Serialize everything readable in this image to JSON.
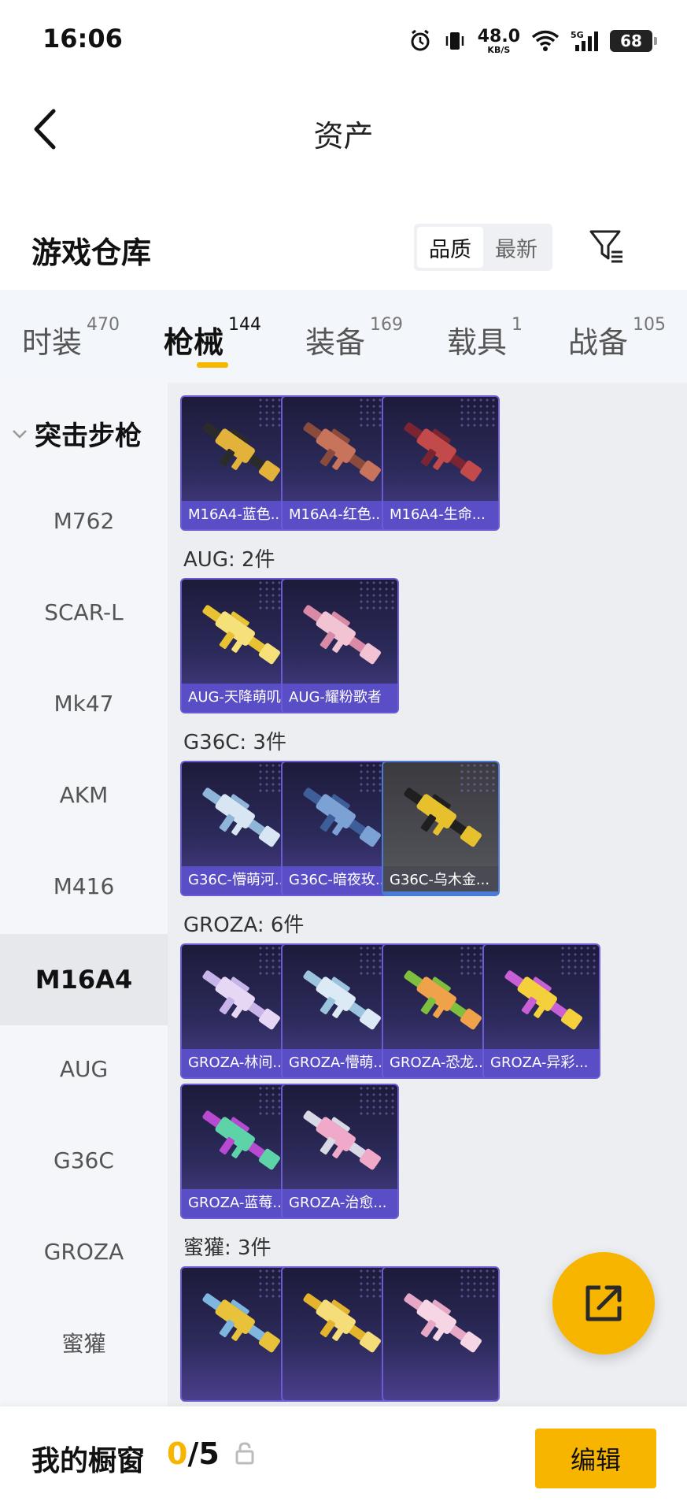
{
  "status_bar": {
    "time": "16:06",
    "net_speed": "48.0",
    "net_unit": "KB/S",
    "network": "5G",
    "battery": "68"
  },
  "header": {
    "title": "资产"
  },
  "warehouse": {
    "title": "游戏仓库",
    "sort_options": [
      "品质",
      "最新"
    ],
    "sort_selected": "品质"
  },
  "tabs": [
    {
      "label": "时装",
      "count": "470"
    },
    {
      "label": "枪械",
      "count": "144"
    },
    {
      "label": "装备",
      "count": "169"
    },
    {
      "label": "载具",
      "count": "1"
    },
    {
      "label": "战备",
      "count": "105"
    }
  ],
  "active_tab": "枪械",
  "sidebar": {
    "group_label": "突击步枪",
    "items": [
      "M762",
      "SCAR-L",
      "Mk47",
      "AKM",
      "M416",
      "M16A4",
      "AUG",
      "G36C",
      "GROZA",
      "蜜獾"
    ],
    "active_item": "M16A4"
  },
  "sections": [
    {
      "title": "",
      "items": [
        {
          "name": "M16A4-蓝色...",
          "color1": "#2b2b2b",
          "color2": "#e2b23a",
          "grey": false
        },
        {
          "name": "M16A4-红色...",
          "color1": "#8a4b3c",
          "color2": "#c8735b",
          "grey": false
        },
        {
          "name": "M16A4-生命...",
          "color1": "#7a2531",
          "color2": "#c24a4a",
          "grey": false
        }
      ]
    },
    {
      "title": "AUG: 2件",
      "items": [
        {
          "name": "AUG-天降萌叽",
          "color1": "#e8c232",
          "color2": "#f5e07a",
          "grey": false
        },
        {
          "name": "AUG-耀粉歌者",
          "color1": "#d98aa6",
          "color2": "#f2c3d3",
          "grey": false
        }
      ]
    },
    {
      "title": "G36C: 3件",
      "items": [
        {
          "name": "G36C-懵萌河...",
          "color1": "#8fb6d9",
          "color2": "#d7e6f2",
          "grey": false
        },
        {
          "name": "G36C-暗夜玫...",
          "color1": "#3e5e9a",
          "color2": "#7ca1d4",
          "grey": false
        },
        {
          "name": "G36C-乌木金...",
          "color1": "#1f1f1f",
          "color2": "#e6c12d",
          "grey": true
        }
      ]
    },
    {
      "title": "GROZA: 6件",
      "items": [
        {
          "name": "GROZA-林间...",
          "color1": "#c7b4e8",
          "color2": "#e6d8f5",
          "grey": false
        },
        {
          "name": "GROZA-懵萌...",
          "color1": "#9cc4de",
          "color2": "#dbeaf4",
          "grey": false
        },
        {
          "name": "GROZA-恐龙...",
          "color1": "#7fbf3e",
          "color2": "#f0a24a",
          "grey": false
        },
        {
          "name": "GROZA-异彩...",
          "color1": "#c95fd6",
          "color2": "#f4d03c",
          "grey": false
        },
        {
          "name": "GROZA-蓝莓...",
          "color1": "#b84ad2",
          "color2": "#5fd3a8",
          "grey": false
        },
        {
          "name": "GROZA-治愈...",
          "color1": "#d9d9e6",
          "color2": "#f1a9c9",
          "grey": false
        }
      ]
    },
    {
      "title": "蜜獾: 3件",
      "items": [
        {
          "name": "",
          "color1": "#7fb6e0",
          "color2": "#e8c23a",
          "grey": false
        },
        {
          "name": "",
          "color1": "#e3b42c",
          "color2": "#f5dd7a",
          "grey": false
        },
        {
          "name": "",
          "color1": "#e7a7c6",
          "color2": "#f6d6e5",
          "grey": false
        }
      ]
    }
  ],
  "bottom_bar": {
    "label": "我的橱窗",
    "current": "0",
    "separator": "/",
    "max": "5",
    "edit_label": "编辑"
  },
  "colors": {
    "accent": "#f7b500",
    "tile_label": "#5a4ec7",
    "tile_border": "#6b5bd6"
  }
}
